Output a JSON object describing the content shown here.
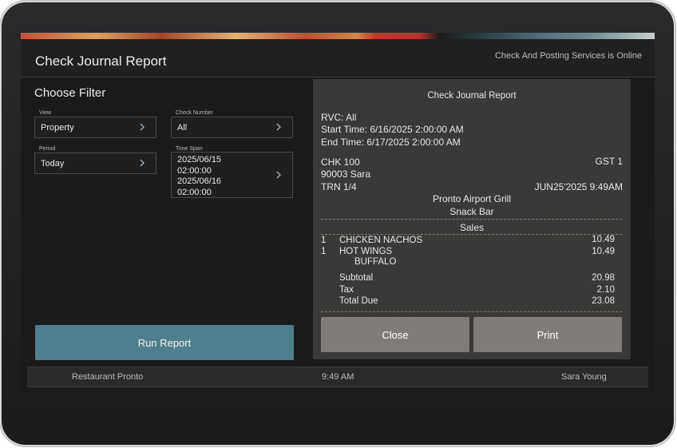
{
  "app": {
    "title": "Check Journal Report",
    "service_status": "Check And Posting Services is Online"
  },
  "filters": {
    "heading": "Choose Filter",
    "view": {
      "label": "View",
      "value": "Property"
    },
    "check_number": {
      "label": "Check Number",
      "value": "All"
    },
    "period": {
      "label": "Period",
      "value": "Today"
    },
    "time_span": {
      "label": "Time Span",
      "start_date": "2025/06/15",
      "start_time": "02:00:00",
      "end_date": "2025/06/16",
      "end_time": "02:00:00"
    },
    "run_button": "Run Report"
  },
  "report": {
    "title": "Check Journal Report",
    "rvc": "RVC: All",
    "start_time": "Start Time: 6/16/2025 2:00:00 AM",
    "end_time": "End Time: 6/17/2025 2:00:00 AM",
    "check": "CHK 100",
    "guests": "GST 1",
    "employee": "90003 Sara",
    "transaction": "TRN 1/4",
    "datetime": "JUN25'2025 9:49AM",
    "location": "Pronto Airport Grill",
    "revenue_center": "Snack Bar",
    "section": "Sales",
    "items": [
      {
        "qty": "1",
        "name": "CHICKEN NACHOS",
        "modifier": "",
        "price": "10.49"
      },
      {
        "qty": "1",
        "name": "HOT WINGS",
        "modifier": "BUFFALO",
        "price": "10.49"
      }
    ],
    "totals": {
      "subtotal_label": "Subtotal",
      "subtotal": "20.98",
      "tax_label": "Tax",
      "tax": "2.10",
      "total_label": "Total Due",
      "total": "23.08"
    },
    "close_button": "Close",
    "print_button": "Print"
  },
  "statusbar": {
    "restaurant": "Restaurant Pronto",
    "time": "9:49 AM",
    "user": "Sara Young"
  },
  "icons": {
    "chevron": "chevron-right-icon"
  },
  "colors": {
    "run_button": "#4f7f8f",
    "report_background": "#3a3937",
    "report_buttons": "#807d79"
  }
}
